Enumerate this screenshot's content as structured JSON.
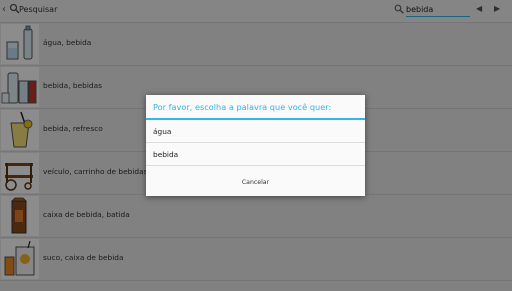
{
  "header": {
    "title": "Pesquisar",
    "search_value": "bebida",
    "back_icon": "chevron-left-icon",
    "search_icon": "search-icon",
    "prev_icon": "triangle-left-icon",
    "next_icon": "triangle-right-icon"
  },
  "list": {
    "items": [
      {
        "label": "água, bebida"
      },
      {
        "label": "bebida, bebidas"
      },
      {
        "label": "bebida, refresco"
      },
      {
        "label": "veículo, carrinho de bebidas"
      },
      {
        "label": "caixa de bebida, batida"
      },
      {
        "label": "suco, caixa de bebida"
      }
    ]
  },
  "dialog": {
    "title": "Por favor, escolha a palavra que você quer:",
    "options": [
      {
        "label": "água"
      },
      {
        "label": "bebida"
      }
    ],
    "cancel_label": "Cancelar"
  },
  "colors": {
    "accent": "#33b5e5",
    "overlay": "rgba(0,0,0,0.45)"
  }
}
